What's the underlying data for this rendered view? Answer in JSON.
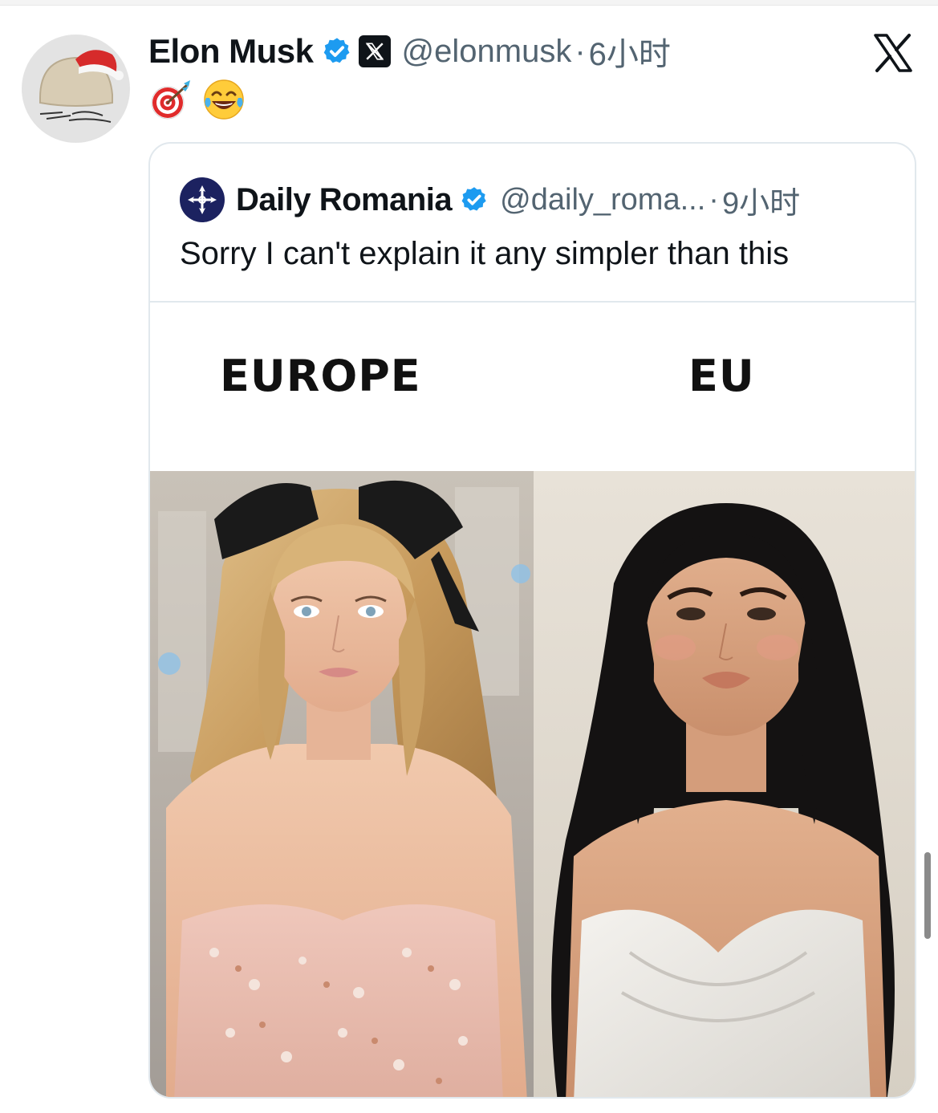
{
  "tweet": {
    "author_name": "Elon Musk",
    "handle": "@elonmusk",
    "separator": "·",
    "timestamp": "6小时",
    "emojis": [
      "direct-hit-emoji",
      "tears-of-joy-emoji"
    ]
  },
  "quoted": {
    "author_name": "Daily Romania",
    "handle": "@daily_roma...",
    "separator": "·",
    "timestamp": "9小时",
    "text": "Sorry I can't explain it any simpler than this",
    "meme": {
      "left_label": "EUROPE",
      "right_label": "EU"
    }
  },
  "colors": {
    "verified_blue": "#1d9bf0",
    "secondary_text": "#536471",
    "card_border": "#e1e8ed"
  },
  "icons": {
    "close": "x-logo-icon",
    "badge": "x-affiliate-badge-icon",
    "verified": "verified-badge-icon"
  }
}
